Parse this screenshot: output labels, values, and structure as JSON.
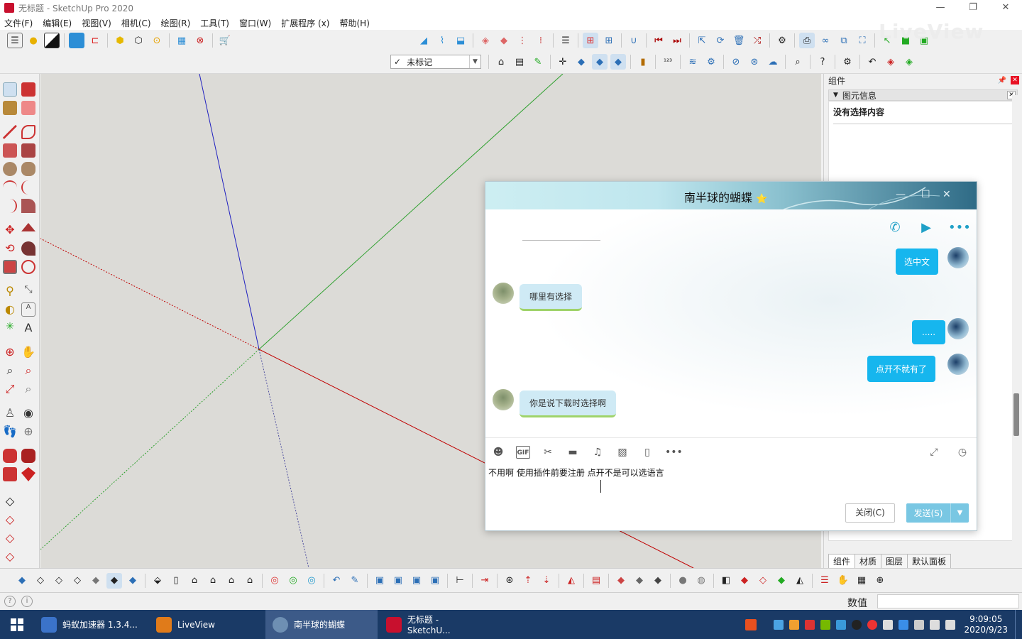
{
  "window": {
    "title": "无标题 - SketchUp Pro 2020",
    "controls": [
      "—",
      "❐",
      "✕"
    ]
  },
  "menu": [
    "文件(F)",
    "编辑(E)",
    "视图(V)",
    "相机(C)",
    "绘图(R)",
    "工具(T)",
    "窗口(W)",
    "扩展程序 (x)",
    "帮助(H)"
  ],
  "toolbar": {
    "tag_check": "✓",
    "tag_value": "未标记"
  },
  "right_panel": {
    "title": "组件",
    "entity_info_header": "图元信息",
    "no_selection": "没有选择内容",
    "tabs": [
      "组件",
      "材质",
      "图层",
      "默认面板"
    ]
  },
  "status": {
    "measurements_label": "数值",
    "measurements_value": ""
  },
  "chat": {
    "contact_name": "南半球的蝴蝶",
    "contact_star": "⭐",
    "messages": [
      {
        "dir": "out",
        "text": "选中文"
      },
      {
        "dir": "in",
        "text": "哪里有选择"
      },
      {
        "dir": "out",
        "text": "....."
      },
      {
        "dir": "out",
        "text": "点开不就有了"
      },
      {
        "dir": "in",
        "text": "你是说下载时选择啊"
      }
    ],
    "input_text": "不用啊   使用插件前要注册 点开不是可以选语言",
    "close_button": "关闭(C)",
    "send_button": "发送(S)"
  },
  "taskbar": {
    "items": [
      {
        "label": "蚂蚁加速器  1.3.4...",
        "color": "#3b73c9"
      },
      {
        "label": "LiveView",
        "color": "#e07b1a"
      },
      {
        "label": "南半球的蝴蝶",
        "color": "#6e8fb3"
      },
      {
        "label": "无标题 - SketchU...",
        "color": "#c8102e"
      }
    ],
    "time": "9:09:05",
    "date": "2020/9/23"
  },
  "watermark": "LiveView",
  "colors": {
    "taskbar": "#1a3a66",
    "canvas": "#dcdbd7",
    "chat_out_bubble": "#16b6ee",
    "chat_in_bubble": "#cfeaf5",
    "send_button": "#79c7e3",
    "axis_red": "#c00000",
    "axis_green": "#2ea02e",
    "axis_blue": "#2020c0"
  }
}
